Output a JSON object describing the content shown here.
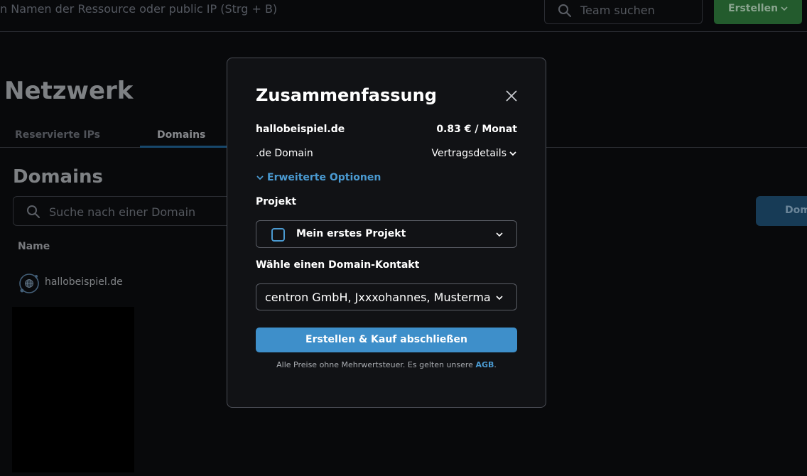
{
  "topbar": {
    "global_search_placeholder": "n Namen der Ressource oder public IP (Strg + B)",
    "team_search_placeholder": "Team suchen",
    "create_button": "Erstellen"
  },
  "page": {
    "title": "Netzwerk",
    "tabs": [
      {
        "label": "Reservierte IPs",
        "active": false
      },
      {
        "label": "Domains",
        "active": true
      }
    ],
    "section_title": "Domains",
    "domain_search_placeholder": "Suche nach einer Domain",
    "right_button_partial": "Dom",
    "table": {
      "column_name": "Name",
      "rows": [
        {
          "name": "hallobeispiel.de"
        }
      ]
    }
  },
  "modal": {
    "title": "Zusammenfassung",
    "domain": "hallobeispiel.de",
    "price": "0.83 € / Monat",
    "tld": ".de Domain",
    "contract_details": "Vertragsdetails",
    "advanced_options": "Erweiterte Optionen",
    "project_label": "Projekt",
    "project_value": "Mein erstes Projekt",
    "contact_label": "Wähle einen Domain-Kontakt",
    "contact_value": "centron GmbH, Jxxxohannes, Mustermann (",
    "submit_button": "Erstellen & Kauf abschließen",
    "footnote_text": "Alle Preise ohne Mehrwertsteuer. Es gelten unsere",
    "footnote_link": "AGB",
    "footnote_end": "."
  },
  "colors": {
    "accent": "#3e8fca",
    "link": "#4a9ad1",
    "create_green": "#2f7a3d",
    "background": "#0b0c0f"
  },
  "icons": [
    "search-icon",
    "chevron-down-icon",
    "close-icon",
    "globe-icon"
  ]
}
